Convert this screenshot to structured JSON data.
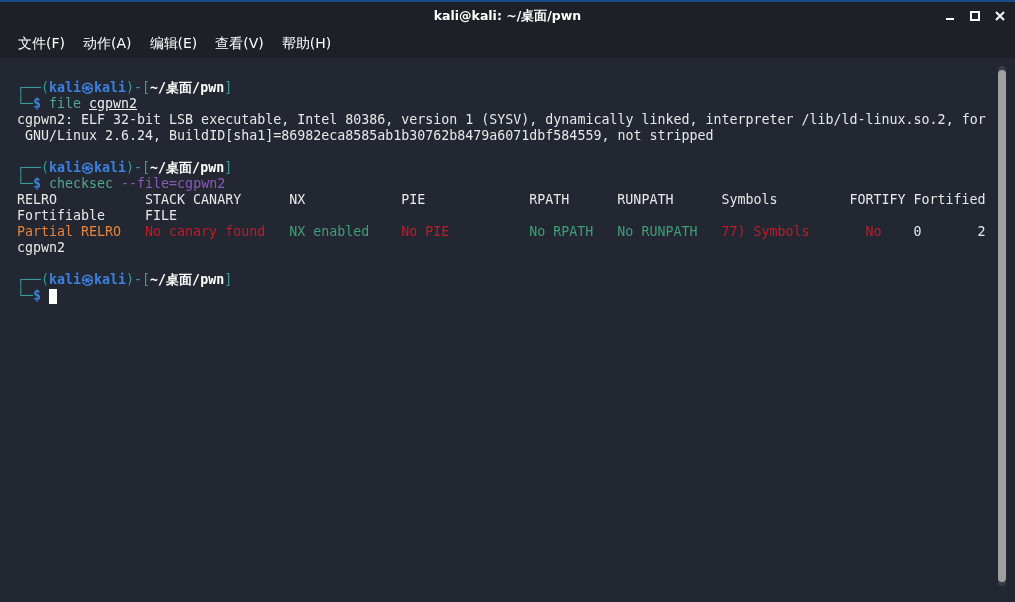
{
  "window": {
    "title": "kali@kali: ~/桌面/pwn"
  },
  "menu": [
    "文件(F)",
    "动作(A)",
    "编辑(E)",
    "查看(V)",
    "帮助(H)"
  ],
  "terminal": [
    {
      "kind": "prompt",
      "frame_start": "┌──(",
      "user_host": "kali㉿kali",
      "frame_mid": ")-[",
      "path": "~/桌面/pwn",
      "frame_end": "]",
      "corner": "└─",
      "sigil": "$",
      "command": "file",
      "argument": "cgpwn2",
      "cursor": false
    },
    {
      "kind": "output",
      "lines": [
        "cgpwn2: ELF 32-bit LSB executable, Intel 80386, version 1 (SYSV), dynamically linked, interpreter /lib/ld-linux.so.2, for",
        " GNU/Linux 2.6.24, BuildID[sha1]=86982eca8585ab1b30762b8479a6071dbf584559, not stripped"
      ]
    },
    {
      "kind": "prompt",
      "frame_start": "┌──(",
      "user_host": "kali㉿kali",
      "frame_mid": ")-[",
      "path": "~/桌面/pwn",
      "frame_end": "]",
      "corner": "└─",
      "sigil": "$",
      "command": "checksec",
      "argument": "--file=cgpwn2",
      "cursor": false
    },
    {
      "kind": "table",
      "header": [
        "RELRO",
        "STACK CANARY",
        "NX",
        "PIE",
        "RPATH",
        "RUNPATH",
        "Symbols",
        "FORTIFY",
        "Fortified",
        "Fortifiable",
        "FILE"
      ],
      "values": [
        {
          "text": "Partial RELRO",
          "color": "#e5843c"
        },
        {
          "text": "No canary found",
          "color": "#c01c28"
        },
        {
          "text": "NX enabled",
          "color": "#3f9e7a"
        },
        {
          "text": "No PIE",
          "color": "#c01c28"
        },
        {
          "text": "No RPATH",
          "color": "#3f9e7a"
        },
        {
          "text": "No RUNPATH",
          "color": "#3f9e7a"
        },
        {
          "text": "77) Symbols",
          "color": "#c01c28"
        },
        {
          "text": "No",
          "color": "#c01c28"
        },
        {
          "text": "0",
          "color": "#e8e8e8"
        },
        {
          "text": "2",
          "color": "#e8e8e8"
        },
        {
          "text": "cgpwn2",
          "color": "#e8e8e8"
        }
      ]
    },
    {
      "kind": "prompt",
      "frame_start": "┌──(",
      "user_host": "kali㉿kali",
      "frame_mid": ")-[",
      "path": "~/桌面/pwn",
      "frame_end": "]",
      "corner": "└─",
      "sigil": "$",
      "cursor": true
    }
  ]
}
